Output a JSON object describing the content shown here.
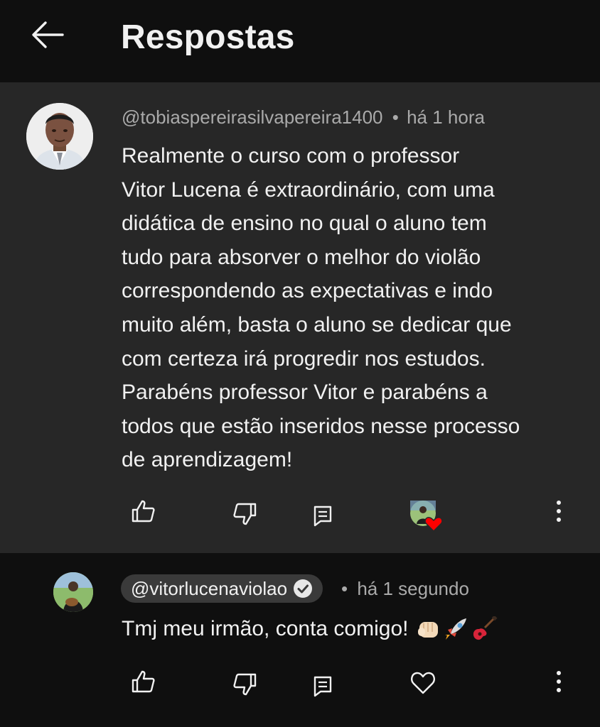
{
  "header": {
    "title": "Respostas",
    "back_icon": "arrow-back-icon"
  },
  "parent_comment": {
    "handle": "@tobiaspereirasilvapereira1400",
    "separator": "•",
    "time": "há 1 hora",
    "text_lines": [
      "Realmente o curso com o professor",
      "Vitor Lucena é extraordinário, com uma",
      "didática de ensino no qual o aluno tem",
      "tudo para absorver o melhor do violão",
      "correspondendo as expectativas e indo",
      "muito além, basta o aluno se dedicar que",
      "com certeza irá progredir nos estudos.",
      "Parabéns professor Vitor e parabéns a",
      "todos que estão inseridos nesse processo",
      "de aprendizagem!"
    ],
    "actions": [
      "thumb-up-icon",
      "thumb-down-icon",
      "reply-icon",
      "creator-heart-icon",
      "more-vert-icon"
    ]
  },
  "reply": {
    "handle": "@vitorlucenaviolao",
    "verified_icon": "verified-check-icon",
    "separator": "•",
    "time": "há 1 segundo",
    "text": "Tmj meu irmão, conta comigo!",
    "emojis": [
      "fist-bump-icon",
      "rocket-icon",
      "guitar-icon"
    ],
    "actions": [
      "thumb-up-icon",
      "thumb-down-icon",
      "reply-icon",
      "heart-icon",
      "more-vert-icon"
    ]
  },
  "colors": {
    "background": "#0f0f0f",
    "highlight_bg": "#272727",
    "text": "#f1f1f1",
    "meta": "#aaaaaa",
    "chip": "#3a3a3a",
    "heart": "#ff0000"
  }
}
